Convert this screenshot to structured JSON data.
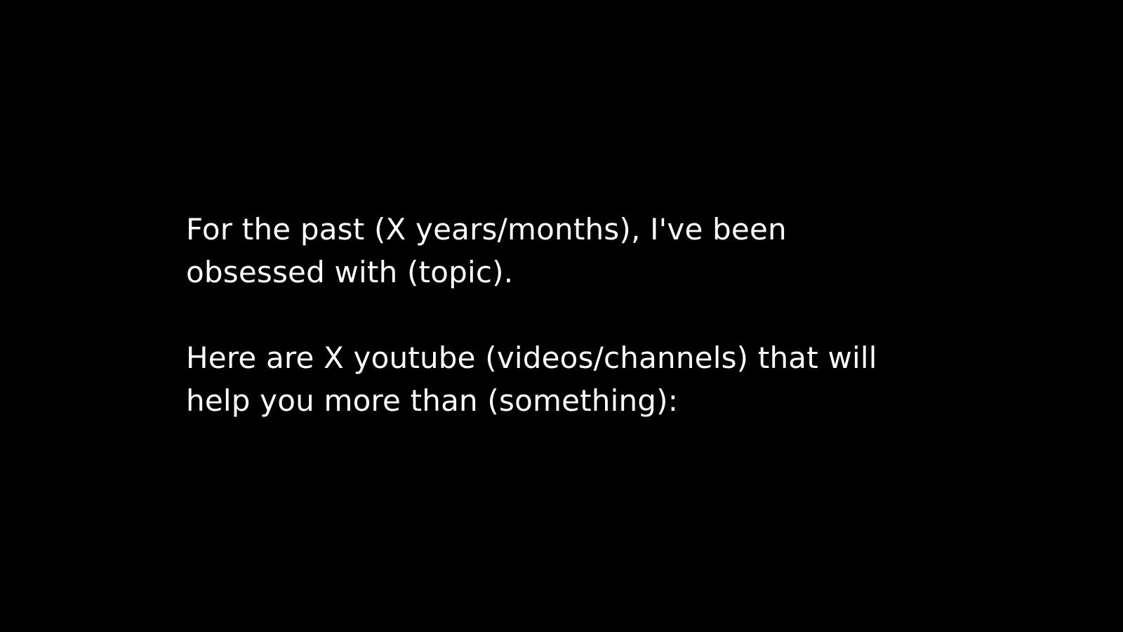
{
  "slide": {
    "background_color": "#000000",
    "text_color": "#ffffff",
    "paragraphs": [
      {
        "lines": [
          "For the past (X years/months), I've been",
          "obsessed with (topic)."
        ]
      },
      {
        "lines": [
          "Here are X youtube (videos/channels) that will",
          "help you more than (something):"
        ]
      }
    ]
  }
}
